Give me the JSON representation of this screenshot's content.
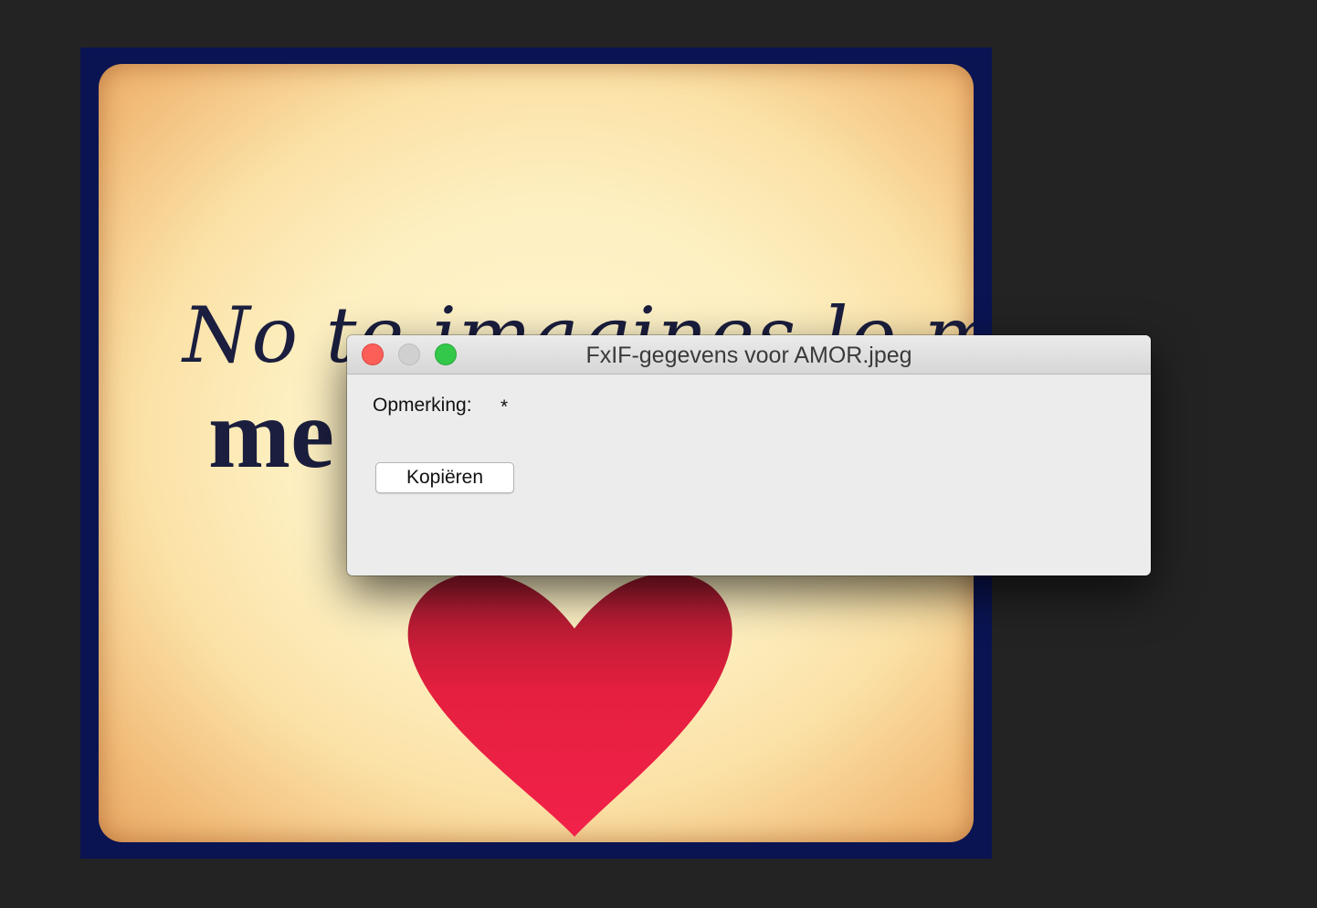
{
  "background_photo": {
    "text_line1": "No te imagines lo mucho que",
    "text_line2": "me",
    "colors": {
      "frame": "#0a1452",
      "paper": "#fdefc0",
      "heart": "#e51f3f",
      "ink": "#1b1e3e"
    }
  },
  "window": {
    "title": "FxIF-gegevens voor AMOR.jpeg",
    "controls": {
      "close": "close-button",
      "minimize": "minimize-button",
      "zoom": "zoom-button"
    },
    "colors": {
      "close": "#fc5f57",
      "minimize": "#d0d0d0",
      "zoom": "#34c84a",
      "background": "#ececec"
    }
  },
  "fields": {
    "comment_label": "Opmerking:",
    "comment_value": "*"
  },
  "actions": {
    "copy_label": "Kopiëren"
  }
}
